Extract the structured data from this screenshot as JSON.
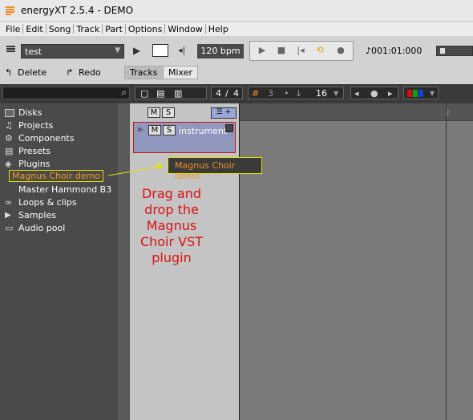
{
  "window": {
    "title": "energyXT 2.5.4 - DEMO",
    "icon": "energyxt-logo-icon"
  },
  "menu": [
    "File",
    "Edit",
    "Song",
    "Track",
    "Part",
    "Options",
    "Window",
    "Help"
  ],
  "toolbar": {
    "project_name": "test",
    "tempo": "120 bpm",
    "position": "♪001:01:000",
    "delete_label": "Delete",
    "redo_label": "Redo",
    "tracks_label": "Tracks",
    "mixer_label": "Mixer"
  },
  "time_signature": {
    "num": "4",
    "sep": "/",
    "den": "4"
  },
  "grid": {
    "snap": "3",
    "quantize": "16"
  },
  "browser": {
    "items": [
      {
        "label": "Disks",
        "icon": "disk-icon"
      },
      {
        "label": "Projects",
        "icon": "note-icon"
      },
      {
        "label": "Components",
        "icon": "gear-icon"
      },
      {
        "label": "Presets",
        "icon": "list-icon"
      },
      {
        "label": "Plugins",
        "icon": "plugin-icon"
      },
      {
        "label": "Magnus Choir demo",
        "icon": ""
      },
      {
        "label": "Master Hammond B3",
        "icon": ""
      },
      {
        "label": "Loops & clips",
        "icon": "loop-icon"
      },
      {
        "label": "Samples",
        "icon": "play-icon"
      },
      {
        "label": "Audio pool",
        "icon": "folder-icon"
      }
    ]
  },
  "track": {
    "name": "instrument",
    "mute_label": "M",
    "solo_label": "S"
  },
  "drag_tag": "Magnus Choir demo",
  "annotation_lines": [
    "Drag and",
    "drop the",
    "Magnus",
    "Choir VST",
    "plugin"
  ],
  "ruler": {
    "mark1": "",
    "mark2": "2"
  },
  "colors": {
    "accent": "#f09020",
    "highlight": "#e8e000",
    "annotation": "#dd1111",
    "track": "#9098c0"
  }
}
